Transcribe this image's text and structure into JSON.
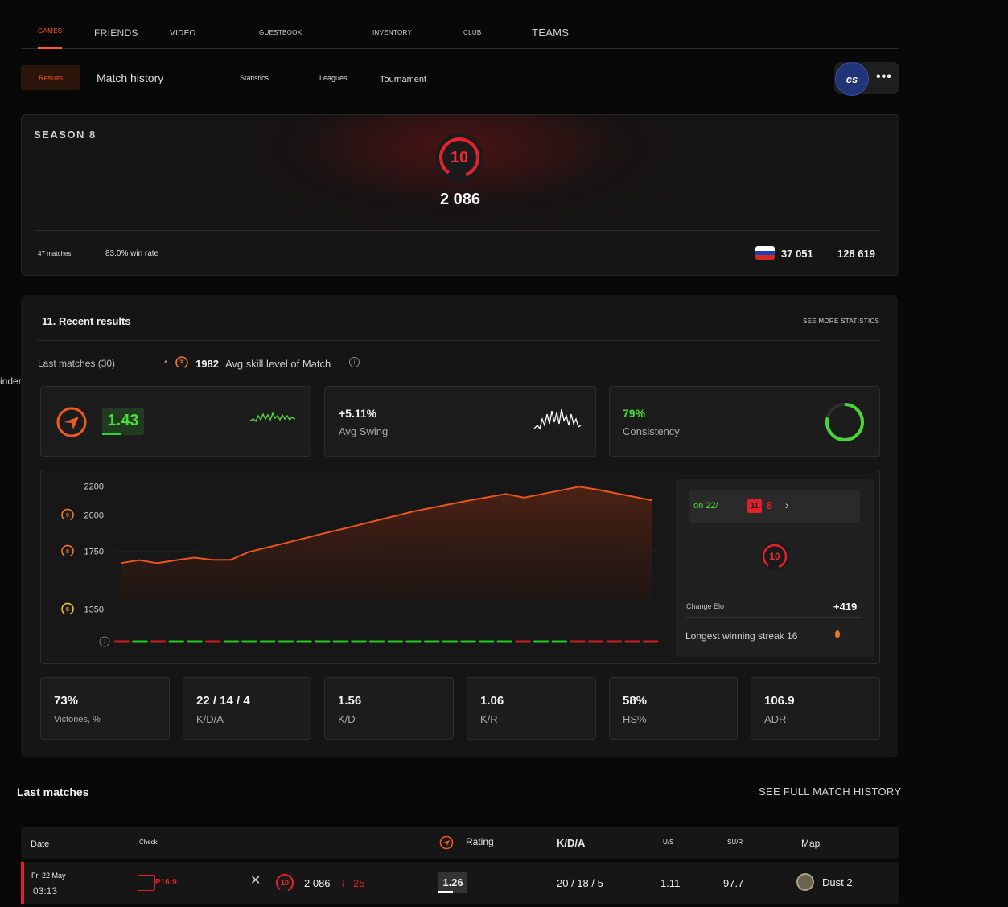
{
  "nav": {
    "games": "GAMES",
    "friends": "FRIENDS",
    "video": "VIDEO",
    "guestbook": "GUESTBOOK",
    "inventory": "INVENTORY",
    "club": "CLUB",
    "teams": "TEAMS"
  },
  "subnav": {
    "results": "Results",
    "match_history": "Match history",
    "statistics": "Statistics",
    "leagues": "Leagues",
    "tournament": "Tournament"
  },
  "profile": {
    "game_logo": "cs",
    "menu": "•••"
  },
  "season": {
    "title": "SEASON 8",
    "level": "10",
    "elo": "2 086",
    "matches": "47 matches",
    "win_rate": "83.0% win rate",
    "country_rank": "37 051",
    "world_rank": "128 619"
  },
  "recent": {
    "title": "11. Recent results",
    "see_more": "SEE MORE STATISTICS",
    "last_matches_label": "Last matches (30)",
    "avg_level": "9",
    "avg_skill": "1982",
    "avg_skill_label": "Avg skill level of Match",
    "side_fragment": "inder",
    "rating": {
      "value": "1.43",
      "fill": 0.45
    },
    "swing": {
      "value": "+5.11%",
      "label": "Avg Swing"
    },
    "consistency": {
      "value": "79%",
      "label": "Consistency",
      "fill": 0.79
    }
  },
  "chart_data": {
    "type": "line",
    "y_ticks": [
      {
        "value": 2200,
        "label": "2200",
        "level": ""
      },
      {
        "value": 2000,
        "label": "2000",
        "level": "9"
      },
      {
        "value": 1750,
        "label": "1750",
        "level": "8"
      },
      {
        "value": 1350,
        "label": "1350",
        "level": "6"
      }
    ],
    "ylim": [
      1230,
      2230
    ],
    "x": [
      1,
      2,
      3,
      4,
      5,
      6,
      7,
      8,
      9,
      10,
      11,
      12,
      13,
      14,
      15,
      16,
      17,
      18,
      19,
      20,
      21,
      22,
      23,
      24,
      25,
      26,
      27,
      28,
      29,
      30
    ],
    "elo": [
      1667,
      1688,
      1667,
      1687,
      1705,
      1690,
      1690,
      1745,
      1775,
      1806,
      1838,
      1870,
      1900,
      1931,
      1963,
      1994,
      2025,
      2050,
      2075,
      2100,
      2122,
      2145,
      2120,
      2145,
      2170,
      2195,
      2175,
      2150,
      2125,
      2100
    ],
    "results": [
      "L",
      "W",
      "L",
      "W",
      "W",
      "L",
      "W",
      "W",
      "W",
      "W",
      "W",
      "W",
      "W",
      "W",
      "W",
      "W",
      "W",
      "W",
      "W",
      "W",
      "W",
      "W",
      "L",
      "W",
      "W",
      "L",
      "L",
      "L",
      "L",
      "L"
    ],
    "colors": {
      "line": "#e8541e",
      "win": "#22c922",
      "loss": "#c81e1e"
    }
  },
  "chart_side": {
    "since": "on 22/",
    "mini_level": "11",
    "mini_value": "8",
    "level": "10",
    "change_elo_label": "Change Elo",
    "change_elo": "+419",
    "streak_label": "Longest winning streak 16"
  },
  "stats": [
    {
      "value": "73%",
      "label": "Victories, %"
    },
    {
      "value": "22 / 14 / 4",
      "label": "K/D/A"
    },
    {
      "value": "1.56",
      "label": "K/D"
    },
    {
      "value": "1.06",
      "label": "K/R"
    },
    {
      "value": "58%",
      "label": "HS%"
    },
    {
      "value": "106.9",
      "label": "ADR"
    }
  ],
  "last_matches": {
    "title": "Last matches",
    "see_full": "SEE FULL MATCH HISTORY",
    "headers": {
      "date": "Date",
      "check": "Check",
      "rating": "Rating",
      "kda": "K/D/A",
      "us": "U/S",
      "sur": "SU/R",
      "map": "Map"
    },
    "rows": [
      {
        "date": "Fri 22 May",
        "time": "03:13",
        "score": "P16:9",
        "level": "10",
        "elo": "2 086",
        "elo_change": "25",
        "rating": "1.26",
        "kda": "20 / 18 / 5",
        "us": "1.11",
        "sur": "97.7",
        "map": "Dust 2"
      }
    ]
  }
}
